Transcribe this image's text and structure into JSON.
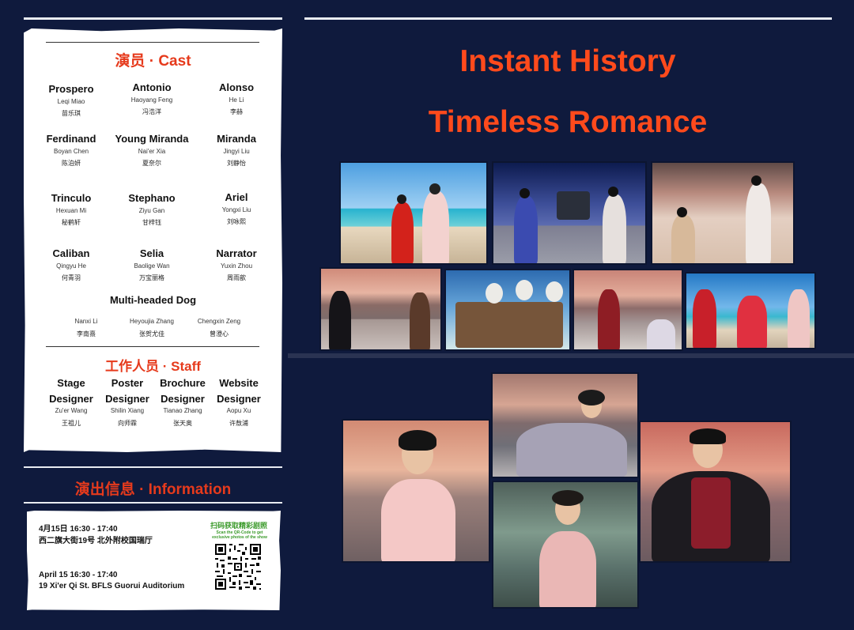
{
  "cast_section": {
    "title": "演员 · Cast",
    "members": [
      {
        "role": "Prospero",
        "name_en": "Leqi Miao",
        "name_zh": "苗乐琪"
      },
      {
        "role": "Antonio",
        "name_en": "Haoyang Feng",
        "name_zh": "冯浩洋"
      },
      {
        "role": "Alonso",
        "name_en": "He Li",
        "name_zh": "李赫"
      },
      {
        "role": "Ferdinand",
        "name_en": "Boyan Chen",
        "name_zh": "陈泊妍"
      },
      {
        "role": "Young Miranda",
        "name_en": "Nai'er Xia",
        "name_zh": "夏奈尔"
      },
      {
        "role": "Miranda",
        "name_en": "Jingyi Liu",
        "name_zh": "刘静怡"
      },
      {
        "role": "Trinculo",
        "name_en": "Hexuan Mi",
        "name_zh": "秘鹤轩"
      },
      {
        "role": "Stephano",
        "name_en": "Ziyu Gan",
        "name_zh": "甘梓钰"
      },
      {
        "role": "Ariel",
        "name_en": "Yongxi Liu",
        "name_zh": "刘咏熙"
      },
      {
        "role": "Caliban",
        "name_en": "Qingyu He",
        "name_zh": "何青羽"
      },
      {
        "role": "Selia",
        "name_en": "Baolige Wan",
        "name_zh": "万宝丽格"
      },
      {
        "role": "Narrator",
        "name_en": "Yuxin Zhou",
        "name_zh": "周雨歆"
      }
    ],
    "dog": {
      "role": "Multi-headed Dog",
      "names": [
        {
          "en": "Nanxi Li",
          "zh": "李南熹"
        },
        {
          "en": "Heyoujia Zhang",
          "zh": "张贺尤佳"
        },
        {
          "en": "Chengxin Zeng",
          "zh": "曾澄心"
        }
      ]
    }
  },
  "staff_section": {
    "title": "工作人员 · Staff",
    "members": [
      {
        "role_line1": "Stage",
        "role_line2": "Designer",
        "name_en": "Zu'er Wang",
        "name_zh": "王祖儿"
      },
      {
        "role_line1": "Poster",
        "role_line2": "Designer",
        "name_en": "Shilin Xiang",
        "name_zh": "向师霖"
      },
      {
        "role_line1": "Brochure",
        "role_line2": "Designer",
        "name_en": "Tianao Zhang",
        "name_zh": "张天奥"
      },
      {
        "role_line1": "Website",
        "role_line2": "Designer",
        "name_en": "Aopu Xu",
        "name_zh": "许敖浦"
      }
    ]
  },
  "info_section": {
    "title": "演出信息 · Information",
    "zh_time": "4月15日 16:30 - 17:40",
    "zh_address": "西二旗大街19号 北外附校国瑞厅",
    "en_time": "April 15  16:30 - 17:40",
    "en_address": "19  Xi'er Qi St.  BFLS Guorui Auditorium",
    "qr_title": "扫码获取精彩剧照",
    "qr_caption_1": "Scan the QR-Code to get",
    "qr_caption_2": "exclusive photos of the show"
  },
  "headline": {
    "line1": "Instant History",
    "line2": "Timeless Romance"
  },
  "colors": {
    "background": "#0f1a3d",
    "accent": "#e63a1c",
    "headline": "#ff4a1c",
    "qr_title": "#3a9a2a"
  }
}
